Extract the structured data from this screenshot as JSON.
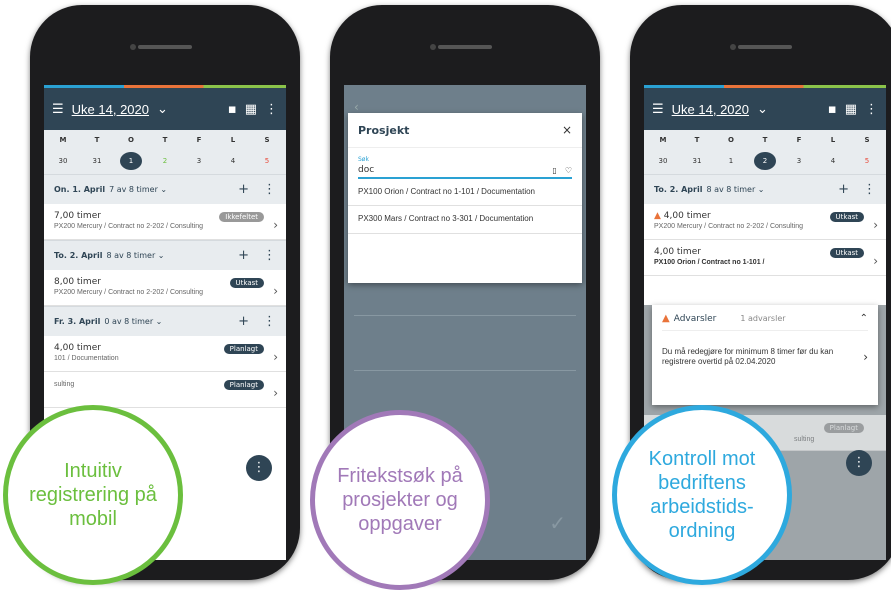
{
  "phone1": {
    "week_title": "Uke 14, 2020",
    "day_letters": [
      "M",
      "T",
      "O",
      "T",
      "F",
      "L",
      "S"
    ],
    "day_numbers": [
      "30",
      "31",
      "1",
      "2",
      "3",
      "4",
      "5"
    ],
    "groups": [
      {
        "date": "On. 1. April",
        "hours": "7 av 8 timer",
        "entries": [
          {
            "hours": "7,00 timer",
            "project": "PX200 Mercury / Contract no 2-202 / Consulting",
            "badge": "Ikkefeltet"
          }
        ]
      },
      {
        "date": "To. 2. April",
        "hours": "8 av 8 timer",
        "entries": [
          {
            "hours": "8,00 timer",
            "project": "PX200 Mercury / Contract no 2-202 / Consulting",
            "badge": "Utkast"
          }
        ]
      },
      {
        "date": "Fr. 3. April",
        "hours": "0 av 8 timer",
        "entries": [
          {
            "hours": "4,00 timer",
            "project": "101 / Documentation",
            "badge": "Planlagt"
          },
          {
            "hours": "",
            "project": "sulting",
            "badge": "Planlagt"
          }
        ]
      }
    ],
    "caption": "Intuitiv registrering på mobil",
    "caption_color": "#6bbf3e"
  },
  "phone2": {
    "modal_title": "Prosjekt",
    "search_label": "Søk",
    "search_value": "doc",
    "results": [
      "PX100 Orion / Contract no 1-101 / Documentation",
      "PX300 Mars / Contract no 3-301 / Documentation"
    ],
    "caption": "Fritekstsøk på prosjekter og oppgaver",
    "caption_color": "#a179b8"
  },
  "phone3": {
    "week_title": "Uke 14, 2020",
    "group_date": "To. 2. April",
    "group_hours": "8 av 8 timer",
    "entry1_hours": "4,00 timer",
    "entry1_project": "PX200 Mercury / Contract no 2-202 / Consulting",
    "entry1_badge": "Utkast",
    "entry2_hours": "4,00 timer",
    "entry2_project": "PX100 Orion / Contract no 1-101 /",
    "entry2_badge": "Utkast",
    "warning_title": "Advarsler",
    "warning_count": "1 advarsler",
    "warning_text": "Du må redegjøre for minimum 8 timer før du kan registrere overtid på 02.04.2020",
    "entry3_badge": "Planlagt",
    "entry3_project": "sulting",
    "caption": "Kontroll mot bedriftens arbeidstids-ordning",
    "caption_color": "#2ea9de"
  }
}
